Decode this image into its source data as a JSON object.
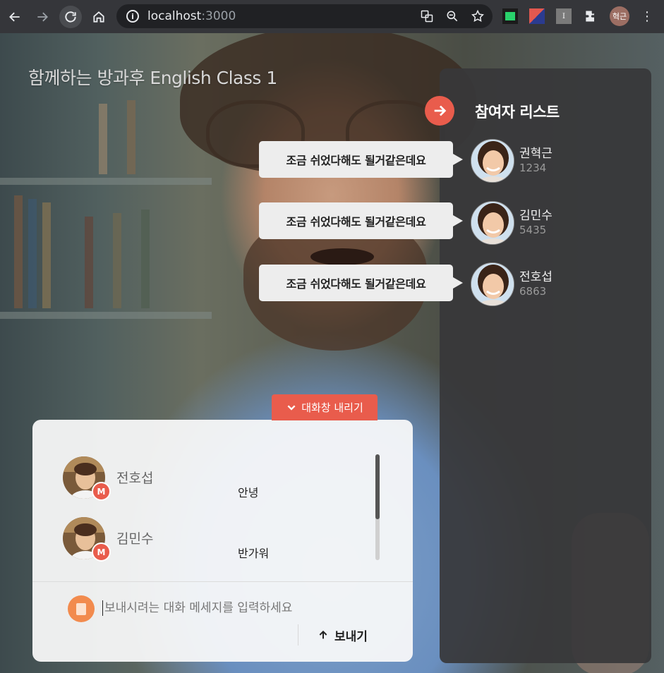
{
  "browser": {
    "url_host": "localhost",
    "url_port": ":3000",
    "profile_initials": "혁근",
    "ext_gray_letter": "I"
  },
  "classroom": {
    "title": "함께하는 방과후 English Class 1"
  },
  "participants_panel": {
    "title": "참여자 리스트",
    "participants": [
      {
        "name": "권혁근",
        "id": "1234",
        "bubble": "조금 쉬었다해도 될거같은데요"
      },
      {
        "name": "김민수",
        "id": "5435",
        "bubble": "조금 쉬었다해도 될거같은데요"
      },
      {
        "name": "전호섭",
        "id": "6863",
        "bubble": "조금 쉬었다해도 될거같은데요"
      }
    ]
  },
  "chat": {
    "toggle_label": "대화창 내리기",
    "messages": [
      {
        "sender": "전호섭",
        "badge": "M",
        "text": "안녕"
      },
      {
        "sender": "김민수",
        "badge": "M",
        "text": "반가워"
      }
    ],
    "input_placeholder": "보내시려는 대화 메세지를 입력하세요",
    "input_value": "",
    "send_label": "보내기"
  },
  "colors": {
    "accent": "#e95c4c",
    "attach": "#f28b4e",
    "panel_bg": "#37373a"
  }
}
